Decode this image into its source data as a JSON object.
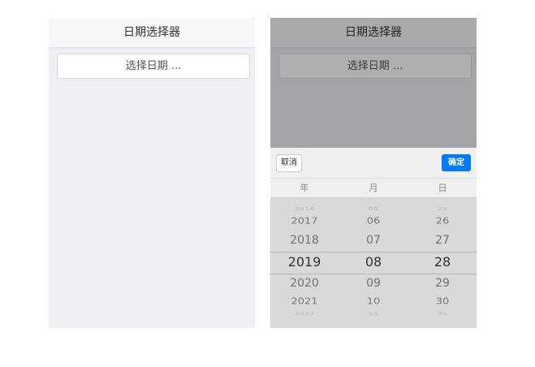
{
  "left_screen": {
    "header_title": "日期选择器",
    "select_button_label": "选择日期 ..."
  },
  "right_screen": {
    "header_title": "日期选择器",
    "select_button_label": "选择日期 ...",
    "picker": {
      "cancel_label": "取消",
      "confirm_label": "确定",
      "columns": [
        {
          "label": "年",
          "items": [
            "2016",
            "2017",
            "2018",
            "2019",
            "2020",
            "2021",
            "2022"
          ],
          "selected": "2019"
        },
        {
          "label": "月",
          "items": [
            "05",
            "06",
            "07",
            "08",
            "09",
            "10",
            "11"
          ],
          "selected": "08"
        },
        {
          "label": "日",
          "items": [
            "25",
            "26",
            "27",
            "28",
            "29",
            "30",
            "31"
          ],
          "selected": "28"
        }
      ]
    }
  },
  "colors": {
    "accent": "#007aff",
    "mask": "rgba(0,0,0,0.31)"
  }
}
